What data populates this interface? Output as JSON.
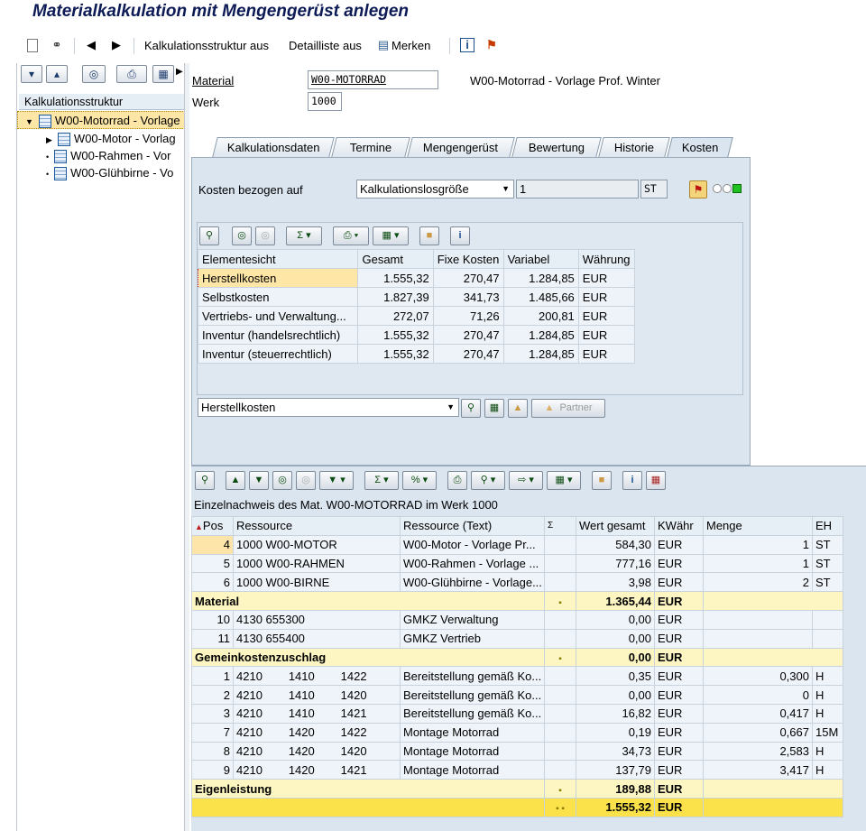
{
  "title": "Materialkalkulation mit Mengengerüst anlegen",
  "toolbar": {
    "kalkulationsstruktur_aus": "Kalkulationsstruktur aus",
    "detailliste_aus": "Detailliste aus",
    "merken": "Merken"
  },
  "tree": {
    "header": "Kalkulationsstruktur",
    "items": [
      {
        "label": "W00-Motorrad - Vorlage"
      },
      {
        "label": "W00-Motor - Vorlag"
      },
      {
        "label": "W00-Rahmen - Vor"
      },
      {
        "label": "W00-Glühbirne - Vo"
      }
    ]
  },
  "fields": {
    "material_label": "Material",
    "material_value": "W00-MOTORRAD",
    "material_text": "W00-Motorrad - Vorlage Prof. Winter",
    "werk_label": "Werk",
    "werk_value": "1000"
  },
  "tabs": [
    "Kalkulationsdaten",
    "Termine",
    "Mengengerüst",
    "Bewertung",
    "Historie",
    "Kosten"
  ],
  "kosten": {
    "label": "Kosten bezogen auf",
    "select": "Kalkulationslosgröße",
    "qty": "1",
    "unit": "ST"
  },
  "grid1": {
    "headers": [
      "Elementesicht",
      "Gesamt",
      "Fixe Kosten",
      "Variabel",
      "Währung"
    ],
    "rows": [
      [
        "Herstellkosten",
        "1.555,32",
        "270,47",
        "1.284,85",
        "EUR"
      ],
      [
        "Selbstkosten",
        "1.827,39",
        "341,73",
        "1.485,66",
        "EUR"
      ],
      [
        "Vertriebs- und Verwaltung...",
        "272,07",
        "71,26",
        "200,81",
        "EUR"
      ],
      [
        "Inventur (handelsrechtlich)",
        "1.555,32",
        "270,47",
        "1.284,85",
        "EUR"
      ],
      [
        "Inventur (steuerrechtlich)",
        "1.555,32",
        "270,47",
        "1.284,85",
        "EUR"
      ]
    ],
    "dropdown": "Herstellkosten",
    "partner": "Partner"
  },
  "detail": {
    "caption": "Einzelnachweis des Mat. W00-MOTORRAD im Werk 1000",
    "headers": [
      "Pos",
      "Ressource",
      "Ressource (Text)",
      "Σ",
      "Wert gesamt",
      "KWähr",
      "Menge",
      "EH"
    ],
    "rows": [
      {
        "t": "row",
        "pos": "4",
        "res": "1000 W00-MOTOR",
        "text": "W00-Motor - Vorlage Pr...",
        "wert": "584,30",
        "kw": "EUR",
        "menge": "1",
        "eh": "ST"
      },
      {
        "t": "row",
        "pos": "5",
        "res": "1000 W00-RAHMEN",
        "text": "W00-Rahmen - Vorlage ...",
        "wert": "777,16",
        "kw": "EUR",
        "menge": "1",
        "eh": "ST"
      },
      {
        "t": "row",
        "pos": "6",
        "res": "1000 W00-BIRNE",
        "text": "W00-Glühbirne - Vorlage...",
        "wert": "3,98",
        "kw": "EUR",
        "menge": "2",
        "eh": "ST"
      },
      {
        "t": "sub",
        "label": "Material",
        "wert": "1.365,44",
        "kw": "EUR"
      },
      {
        "t": "row",
        "pos": "10",
        "res": "4130 655300",
        "text": "GMKZ Verwaltung",
        "wert": "0,00",
        "kw": "EUR",
        "menge": "",
        "eh": ""
      },
      {
        "t": "row",
        "pos": "11",
        "res": "4130 655400",
        "text": "GMKZ Vertrieb",
        "wert": "0,00",
        "kw": "EUR",
        "menge": "",
        "eh": ""
      },
      {
        "t": "sub",
        "label": "Gemeinkostenzuschlag",
        "wert": "0,00",
        "kw": "EUR"
      },
      {
        "t": "row",
        "pos": "1",
        "res": "4210        1410        1422",
        "text": "Bereitstellung gemäß Ko...",
        "wert": "0,35",
        "kw": "EUR",
        "menge": "0,300",
        "eh": "H"
      },
      {
        "t": "row",
        "pos": "2",
        "res": "4210        1410        1420",
        "text": "Bereitstellung gemäß Ko...",
        "wert": "0,00",
        "kw": "EUR",
        "menge": "0",
        "eh": "H"
      },
      {
        "t": "row",
        "pos": "3",
        "res": "4210        1410        1421",
        "text": "Bereitstellung gemäß Ko...",
        "wert": "16,82",
        "kw": "EUR",
        "menge": "0,417",
        "eh": "H"
      },
      {
        "t": "row",
        "pos": "7",
        "res": "4210        1420        1422",
        "text": "Montage Motorrad",
        "wert": "0,19",
        "kw": "EUR",
        "menge": "0,667",
        "eh": "15M"
      },
      {
        "t": "row",
        "pos": "8",
        "res": "4210        1420        1420",
        "text": "Montage Motorrad",
        "wert": "34,73",
        "kw": "EUR",
        "menge": "2,583",
        "eh": "H"
      },
      {
        "t": "row",
        "pos": "9",
        "res": "4210        1420        1421",
        "text": "Montage Motorrad",
        "wert": "137,79",
        "kw": "EUR",
        "menge": "3,417",
        "eh": "H"
      },
      {
        "t": "sub",
        "label": "Eigenleistung",
        "wert": "189,88",
        "kw": "EUR"
      },
      {
        "t": "tot",
        "label": "",
        "wert": "1.555,32",
        "kw": "EUR"
      }
    ]
  }
}
